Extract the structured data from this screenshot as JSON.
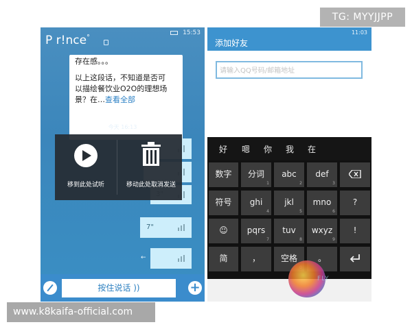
{
  "watermarks": {
    "tg": "TG: MYYJJPP",
    "site": "www.k8kaifa-official.com"
  },
  "left_phone": {
    "status_time": "15:53",
    "app_title": "P r!nce",
    "app_title_sup": "°",
    "message_lines": [
      "存在感。。。",
      "以上这段话，不知道是否可",
      "以描绘餐饮业O2O的理想场",
      "景？在…"
    ],
    "message_link": "查看全部",
    "time_label": "今天 16:13",
    "voice_bubbles": [
      {
        "duration": "3\""
      },
      {
        "duration": "7\""
      }
    ],
    "voice_panel": {
      "play_label": "移到此处试听",
      "delete_label": "移动此处取消发送"
    },
    "hold_to_talk": "按住说话 ))",
    "plus_label": "+"
  },
  "right_phone": {
    "status_time": "11:03",
    "title": "添加好友",
    "search_placeholder": "请输入QQ号码/邮箱地址",
    "candidates": [
      "好",
      "嗯",
      "你",
      "我",
      "在"
    ],
    "keys": [
      {
        "label": "数字"
      },
      {
        "label": "分词",
        "sub": "1"
      },
      {
        "label": "abc",
        "sub": "2"
      },
      {
        "label": "def",
        "sub": "3"
      },
      {
        "label": "backspace-icon"
      },
      {
        "label": "符号"
      },
      {
        "label": "ghi",
        "sub": "4"
      },
      {
        "label": "jkl",
        "sub": "5"
      },
      {
        "label": "mno",
        "sub": "6"
      },
      {
        "label": "?"
      },
      {
        "label": "☺"
      },
      {
        "label": "pqrs",
        "sub": "7"
      },
      {
        "label": "tuv",
        "sub": "8"
      },
      {
        "label": "wxyz",
        "sub": "9"
      },
      {
        "label": "!"
      },
      {
        "label": "简"
      },
      {
        "label": "，"
      },
      {
        "label": "空格",
        "sub": "0"
      },
      {
        "label": "。"
      },
      {
        "label": "enter-icon"
      }
    ],
    "logo_text": "FLY"
  }
}
